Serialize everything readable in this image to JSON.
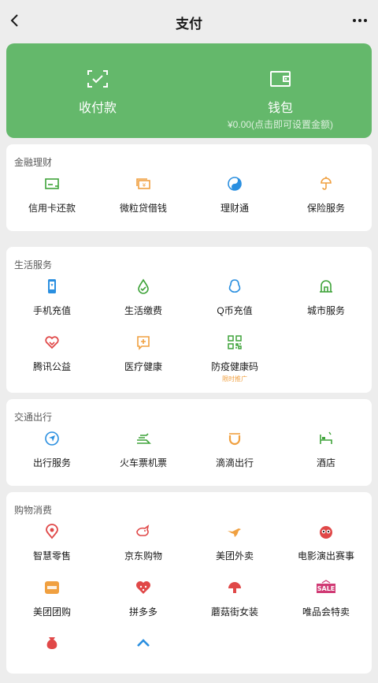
{
  "header": {
    "title": "支付"
  },
  "hero": {
    "receive_label": "收付款",
    "wallet_label": "钱包",
    "wallet_balance": "¥0.00(点击即可设置金额)",
    "background_color": "#64b86b"
  },
  "sections": {
    "finance": {
      "title": "金融理财",
      "items": [
        "信用卡还款",
        "微粒贷借钱",
        "理财通",
        "保险服务"
      ]
    },
    "life": {
      "title": "生活服务",
      "items": [
        "手机充值",
        "生活缴费",
        "Q币充值",
        "城市服务",
        "腾讯公益",
        "医疗健康",
        "防疫健康码"
      ],
      "promo_tag": "限时推广"
    },
    "travel": {
      "title": "交通出行",
      "items": [
        "出行服务",
        "火车票机票",
        "滴滴出行",
        "酒店"
      ]
    },
    "shopping": {
      "title": "购物消费",
      "items": [
        "智慧零售",
        "京东购物",
        "美团外卖",
        "电影演出赛事",
        "美团团购",
        "拼多多",
        "蘑菇街女装",
        "唯品会特卖"
      ]
    }
  }
}
